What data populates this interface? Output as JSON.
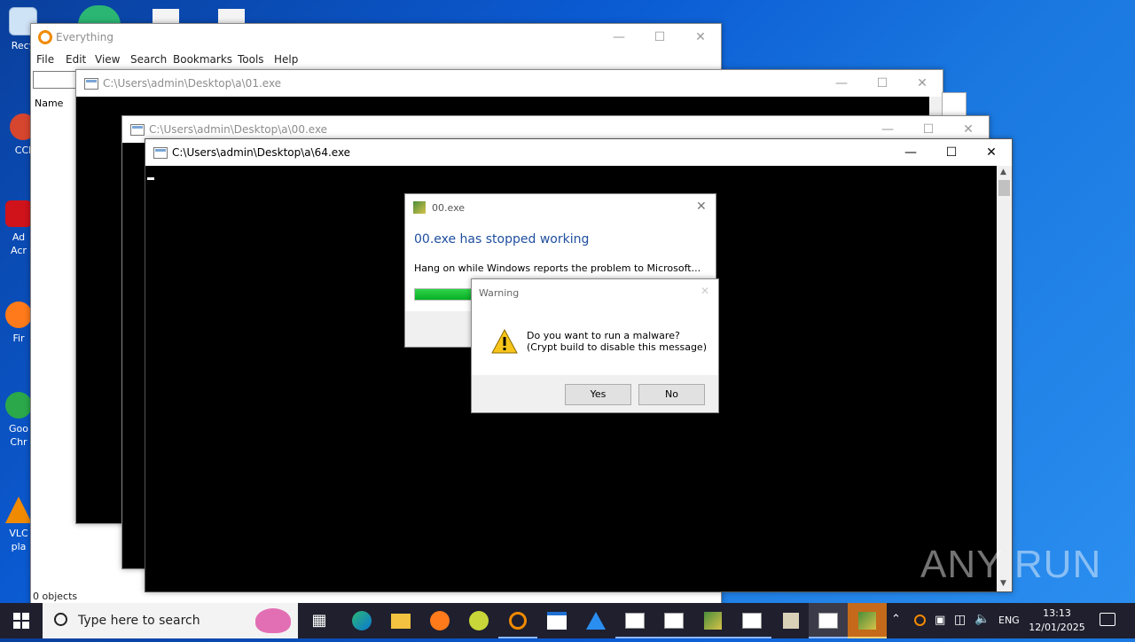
{
  "desktop": {
    "icons": [
      {
        "label": "Recy",
        "color": "#cfe3f7"
      },
      {
        "label": "CCl",
        "color": "#d6452e"
      },
      {
        "label": "Ad Acr",
        "color": "#d0121b"
      },
      {
        "label": "Fir",
        "color": "#ff7a1a"
      },
      {
        "label": "Goo Chr",
        "color": "#2aa84a"
      },
      {
        "label": "VLC pla",
        "color": "#f08a00"
      }
    ]
  },
  "everything_window": {
    "title": "Everything",
    "menu": [
      "File",
      "Edit",
      "View",
      "Search",
      "Bookmarks",
      "Tools",
      "Help"
    ],
    "column_name": "Name",
    "status": "0 objects"
  },
  "console_01": {
    "title": "C:\\Users\\admin\\Desktop\\a\\01.exe"
  },
  "console_00": {
    "title": "C:\\Users\\admin\\Desktop\\a\\00.exe"
  },
  "console_64": {
    "title": "C:\\Users\\admin\\Desktop\\a\\64.exe"
  },
  "error_dialog": {
    "title": "00.exe",
    "heading": "00.exe has stopped working",
    "message": "Hang on while Windows reports the problem to Microsoft...",
    "progress": 0.45
  },
  "warning_dialog": {
    "title": "Warning",
    "line1": "Do you want to run a malware?",
    "line2": "(Crypt build to disable this message)",
    "yes": "Yes",
    "no": "No"
  },
  "watermark": "ANY RUN",
  "taskbar": {
    "search_placeholder": "Type here to search",
    "language": "ENG",
    "time": "13:13",
    "date": "12/01/2025"
  },
  "colors": {
    "heading_blue": "#1e4e9e",
    "progress_green": "#06b025",
    "taskbar_bg": "#1f1f2e"
  }
}
